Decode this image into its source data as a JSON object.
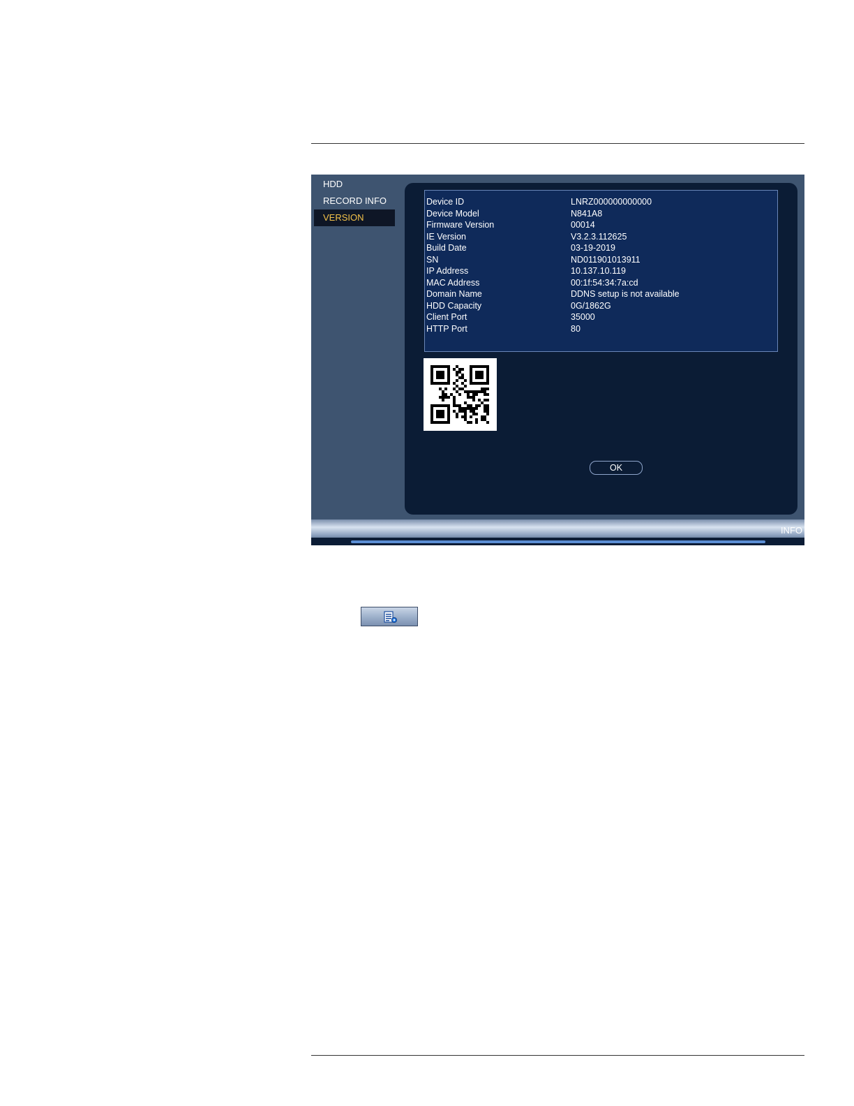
{
  "sidebar": {
    "items": [
      {
        "label": "HDD",
        "active": false
      },
      {
        "label": "RECORD INFO",
        "active": false
      },
      {
        "label": "VERSION",
        "active": true
      }
    ]
  },
  "version_info": {
    "rows": [
      {
        "key": "Device ID",
        "value": "LNRZ000000000000"
      },
      {
        "key": "Device Model",
        "value": "N841A8"
      },
      {
        "key": "Firmware Version",
        "value": "00014"
      },
      {
        "key": "IE Version",
        "value": "V3.2.3.112625"
      },
      {
        "key": "Build Date",
        "value": "03-19-2019"
      },
      {
        "key": "SN",
        "value": "ND011901013911"
      },
      {
        "key": "IP Address",
        "value": "10.137.10.119"
      },
      {
        "key": "MAC Address",
        "value": "00:1f:54:34:7a:cd"
      },
      {
        "key": "Domain Name",
        "value": "DDNS setup is not available"
      },
      {
        "key": "HDD Capacity",
        "value": "0G/1862G"
      },
      {
        "key": "Client Port",
        "value": "35000"
      },
      {
        "key": "HTTP Port",
        "value": "80"
      }
    ]
  },
  "qr": {
    "icon": "qr-code-icon"
  },
  "ok_button": {
    "label": "OK"
  },
  "status_bar": {
    "label": "INFO"
  },
  "menu_icon_button": {
    "icon": "info-list-icon"
  },
  "colors": {
    "panel_bg": "#0b1c35",
    "info_box_bg": "#0f2a5a",
    "sidebar_bg": "#3e5470",
    "active_text": "#f3c24a"
  }
}
